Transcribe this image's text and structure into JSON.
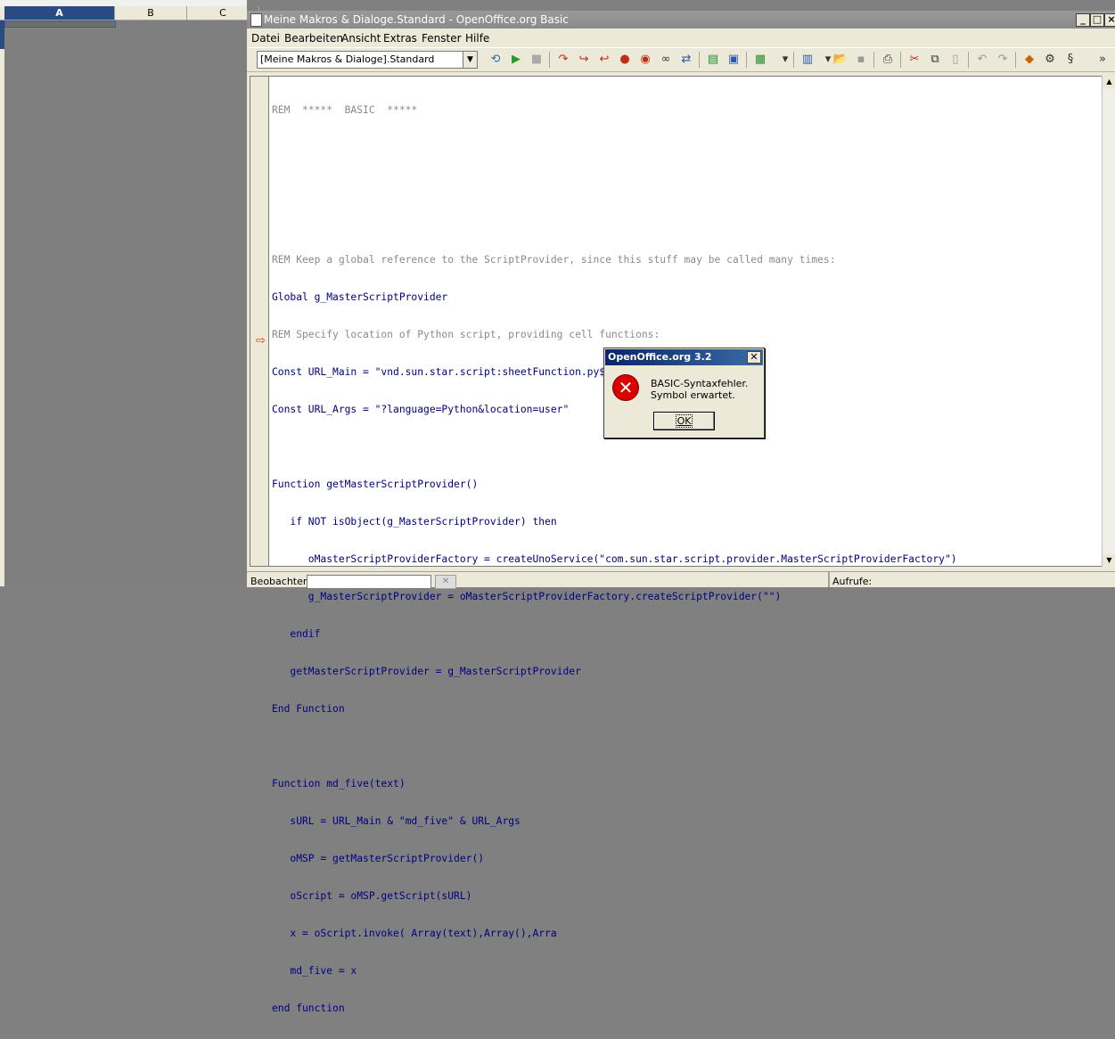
{
  "sheet": {
    "columns": [
      "A",
      "B",
      "C"
    ]
  },
  "window": {
    "title": "Meine Makros & Dialoge.Standard - OpenOffice.org Basic",
    "controls": [
      "_",
      "□",
      "×"
    ]
  },
  "menubar": {
    "items": [
      "Datei",
      "Bearbeiten",
      "Ansicht",
      "Extras",
      "Fenster",
      "Hilfe"
    ]
  },
  "toolbar": {
    "library_select": "[Meine Makros & Dialoge].Standard"
  },
  "editor": {
    "lines": [
      "REM  *****  BASIC  *****",
      "",
      "",
      "",
      "REM Keep a global reference to the ScriptProvider, since this stuff may be called many times:",
      "Global g_MasterScriptProvider",
      "REM Specify location of Python script, providing cell functions:",
      "Const URL_Main = \"vnd.sun.star.script:sheetFunction.py$\"",
      "Const URL_Args = \"?language=Python&location=user\"",
      "",
      "Function getMasterScriptProvider()",
      "   if NOT isObject(g_MasterScriptProvider) then",
      "      oMasterScriptProviderFactory = createUnoService(\"com.sun.star.script.provider.MasterScriptProviderFactory\")",
      "      g_MasterScriptProvider = oMasterScriptProviderFactory.createScriptProvider(\"\")",
      "   endif",
      "   getMasterScriptProvider = g_MasterScriptProvider",
      "End Function",
      "",
      "Function md_five(text)",
      "   sURL = URL_Main & \"md_five\" & URL_Args",
      "   oMSP = getMasterScriptProvider()",
      "   oScript = oMSP.getScript(sURL)",
      "   x = oScript.invoke( Array(text),Array(),Arra",
      "   md_five = x",
      "end function"
    ]
  },
  "bottombar": {
    "watch_label": "Beobachter:",
    "calls_label": "Aufrufe:"
  },
  "dialog": {
    "title": "OpenOffice.org 3.2",
    "message_line1": "BASIC-Syntaxfehler.",
    "message_line2": "Symbol erwartet.",
    "ok_label": "OK"
  }
}
